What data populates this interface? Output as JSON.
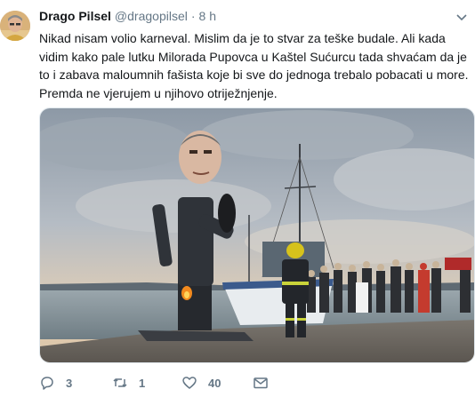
{
  "tweet": {
    "author_name": "Drago Pilsel",
    "author_handle": "@dragopilsel",
    "separator": "·",
    "time": "8 h",
    "text": "Nikad nisam volio karneval. Mislim da je to stvar za teške budale. Ali kada vidim kako pale lutku Milorada Pupovca u Kaštel Sućurcu tada shvaćam da je to i zabava maloumnih fašista koje bi sve do jednoga trebalo pobacati u more. Premda ne vjerujem u njihovo otriježnjenje.",
    "reply_count": "3",
    "retweet_count": "1",
    "like_count": "40"
  },
  "icons": {
    "reply": "reply-icon",
    "retweet": "retweet-icon",
    "like": "heart-icon",
    "dm": "direct-message-icon",
    "more": "chevron-down-icon"
  },
  "colors": {
    "text": "#14171a",
    "secondary": "#657786",
    "border": "#e1e8ed"
  }
}
